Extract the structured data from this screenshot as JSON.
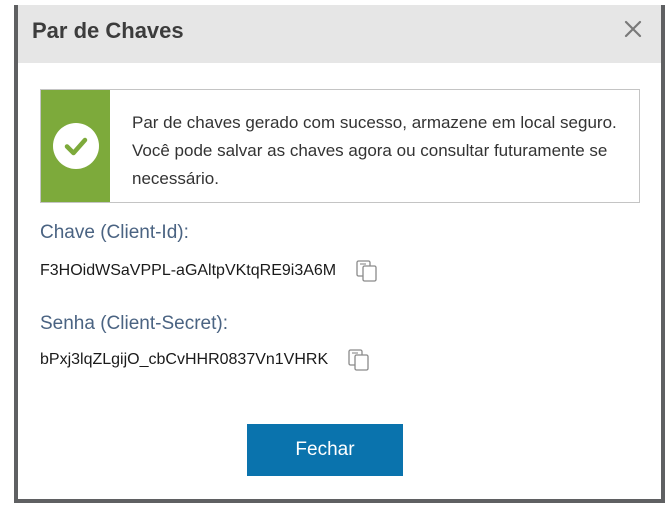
{
  "dialog": {
    "title": "Par de Chaves",
    "close_icon": "close-icon"
  },
  "alert": {
    "icon": "check-circle-icon",
    "message": "Par de chaves gerado com sucesso, armazene em local seguro. Você pode salvar as chaves agora ou consultar futuramente se necessário.",
    "accent_color": "#7daa3b"
  },
  "client_id": {
    "label": "Chave (Client-Id):",
    "value": "F3HOidWSaVPPL-aGAltpVKtqRE9i3A6M",
    "copy_icon": "copy-icon"
  },
  "client_secret": {
    "label": "Senha (Client-Secret):",
    "value": "bPxj3lqZLgijO_cbCvHHR0837Vn1VHRK",
    "copy_icon": "copy-icon"
  },
  "footer": {
    "close_button_label": "Fechar",
    "button_color": "#0a73ad"
  }
}
